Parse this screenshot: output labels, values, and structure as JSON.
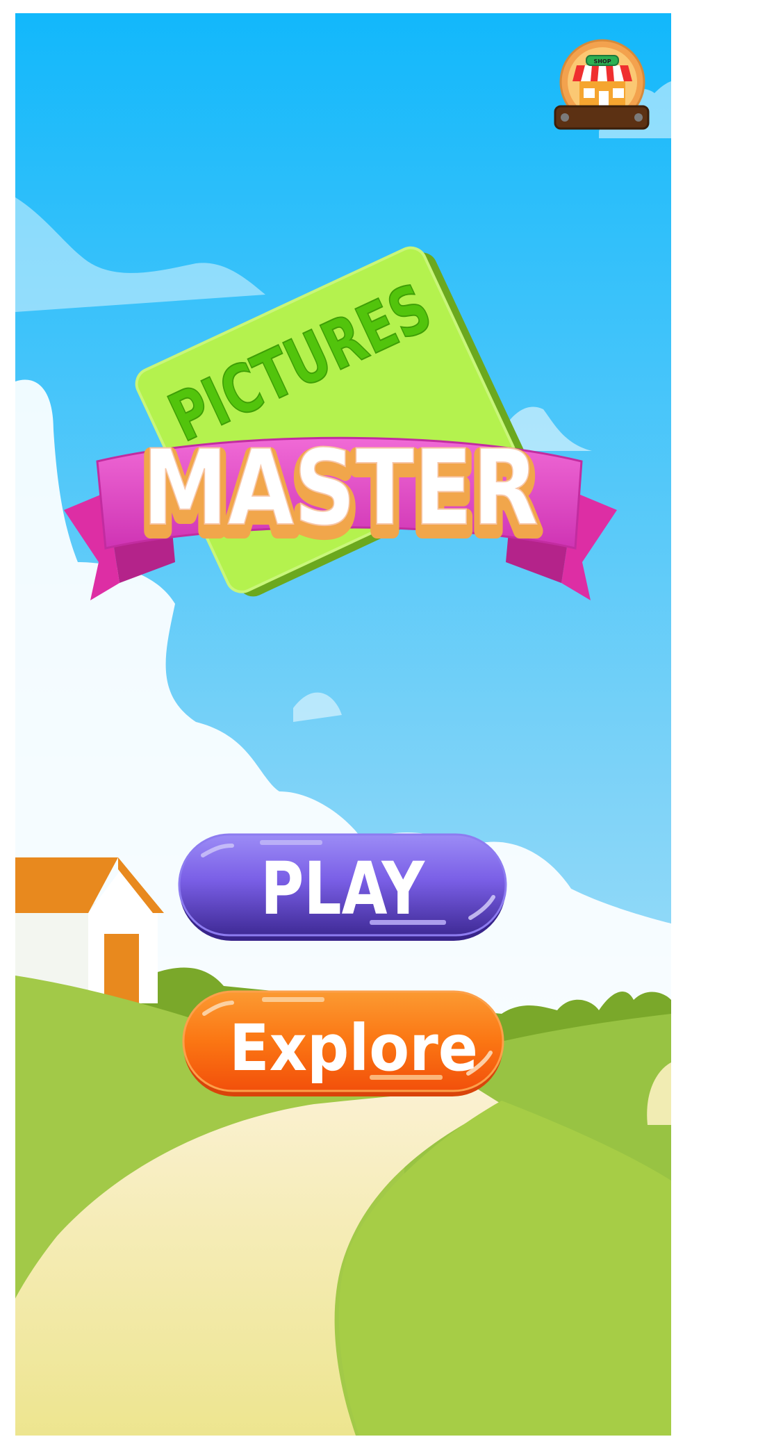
{
  "colors": {
    "sky_top": "#12b8fb",
    "sky_bottom": "#cdeefa",
    "hill_green": "#a5cd48",
    "path_cream": "#f3ecb0",
    "logo_green": "#b4f24e",
    "logo_text_green": "#52c40c",
    "ribbon_pink": "#e350c8",
    "play_purple": "#7a5fe6",
    "explore_orange": "#fb7613",
    "shop_frame": "#f3a24e"
  },
  "shop": {
    "sign": "SHOP",
    "icon": "shop-icon"
  },
  "logo": {
    "line1": "PICTURES",
    "line2": "MASTER"
  },
  "buttons": {
    "play": "PLAY",
    "explore": "Explore"
  }
}
